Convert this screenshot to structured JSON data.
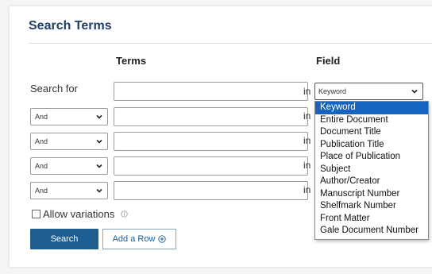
{
  "section_title": "Search Terms",
  "columns": {
    "terms": "Terms",
    "field": "Field"
  },
  "search_for_label": "Search for",
  "in_label": "in",
  "rows": [
    {
      "operator": "And",
      "term": ""
    },
    {
      "operator": "And",
      "term": ""
    },
    {
      "operator": "And",
      "term": ""
    },
    {
      "operator": "And",
      "term": ""
    }
  ],
  "first_term": "",
  "field_select": {
    "selected": "Keyword",
    "options": [
      "Keyword",
      "Entire Document",
      "Document Title",
      "Publication Title",
      "Place of Publication",
      "Subject",
      "Author/Creator",
      "Manuscript Number",
      "Shelfmark Number",
      "Front Matter",
      "Gale Document Number"
    ]
  },
  "allow_variations": {
    "label": "Allow variations",
    "checked": false
  },
  "buttons": {
    "search": "Search",
    "add_row": "Add a Row"
  },
  "colors": {
    "title": "#1f3f66",
    "primary": "#1d5d8f",
    "highlight": "#1565c0"
  }
}
